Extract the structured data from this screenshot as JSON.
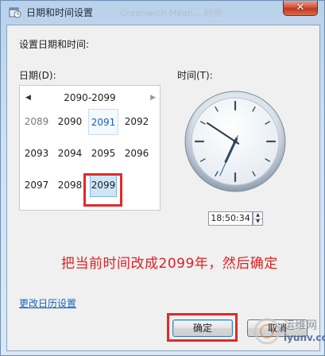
{
  "window": {
    "title": "日期和时间设置",
    "ghost_title": "Greenwich Mean... 时间"
  },
  "dialog": {
    "heading": "设置日期和时间:",
    "date_label": "日期(D):",
    "time_label": "时间(T):"
  },
  "calendar": {
    "header": "2090-2099",
    "prev_arrow": "◀",
    "next_arrow": "▶",
    "years": [
      [
        "2089",
        "2090",
        "2091",
        "2092"
      ],
      [
        "2093",
        "2094",
        "2095",
        "2096"
      ],
      [
        "2097",
        "2098",
        "2099"
      ]
    ],
    "today": "2091",
    "selected": "2099"
  },
  "time": {
    "value": "18:50:34",
    "hour": 18,
    "minute": 50,
    "second": 34
  },
  "annotation": "把当前时间改成2099年，然后确定",
  "link": "更改日历设置",
  "buttons": {
    "ok": "确定",
    "cancel": "取消"
  },
  "watermark": {
    "cn": "运维网",
    "url": "iyunv.com"
  },
  "colors": {
    "annotation_red": "#e02020",
    "highlight_box": "#e02a2a",
    "link_blue": "#1a62b8"
  },
  "icons": {
    "title_icon": "clock-calendar-icon",
    "close": "close-icon"
  }
}
